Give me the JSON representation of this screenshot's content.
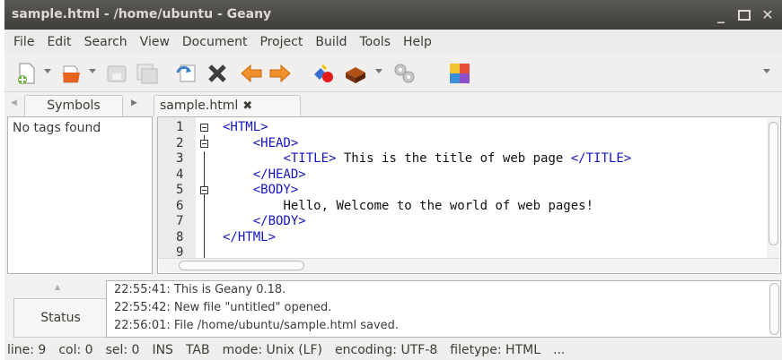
{
  "window": {
    "title": "sample.html - /home/ubuntu - Geany"
  },
  "menu": [
    "File",
    "Edit",
    "Search",
    "View",
    "Document",
    "Project",
    "Build",
    "Tools",
    "Help"
  ],
  "toolbar": {
    "icons": [
      "new-file-icon",
      "open-file-icon",
      "save-icon",
      "save-all-icon",
      "revert-icon",
      "close-icon",
      "back-arrow-icon",
      "forward-arrow-icon",
      "compile-icon",
      "build-icon",
      "execute-gears-icon",
      "color-chooser-icon"
    ]
  },
  "sidebar": {
    "tab_label": "Symbols",
    "empty_text": "No tags found"
  },
  "editor": {
    "tab_label": "sample.html",
    "lines": [
      {
        "num": "1",
        "indent": "",
        "tag1": "<HTML>",
        "text": "",
        "tag2": ""
      },
      {
        "num": "2",
        "indent": "    ",
        "tag1": "<HEAD>",
        "text": "",
        "tag2": ""
      },
      {
        "num": "3",
        "indent": "        ",
        "tag1": "<TITLE>",
        "text": " This is the title of web page ",
        "tag2": "</TITLE>"
      },
      {
        "num": "4",
        "indent": "    ",
        "tag1": "</HEAD>",
        "text": "",
        "tag2": ""
      },
      {
        "num": "5",
        "indent": "    ",
        "tag1": "<BODY>",
        "text": "",
        "tag2": ""
      },
      {
        "num": "6",
        "indent": "        ",
        "tag1": "",
        "text": "Hello, Welcome to the world of web pages!",
        "tag2": ""
      },
      {
        "num": "7",
        "indent": "    ",
        "tag1": "</BODY>",
        "text": "",
        "tag2": ""
      },
      {
        "num": "8",
        "indent": "",
        "tag1": "</HTML>",
        "text": "",
        "tag2": ""
      },
      {
        "num": "9",
        "indent": "",
        "tag1": "",
        "text": "",
        "tag2": ""
      }
    ]
  },
  "messages": {
    "tab_label": "Status",
    "lines": [
      "22:55:41: This is Geany 0.18.",
      "22:55:42: New file \"untitled\" opened.",
      "22:56:01: File /home/ubuntu/sample.html saved."
    ]
  },
  "status": {
    "line": "line: 9",
    "col": "col: 0",
    "sel": "sel: 0",
    "ins": "INS",
    "tab": "TAB",
    "mode": "mode: Unix (LF)",
    "encoding": "encoding: UTF-8",
    "filetype": "filetype: HTML",
    "more": "..."
  }
}
